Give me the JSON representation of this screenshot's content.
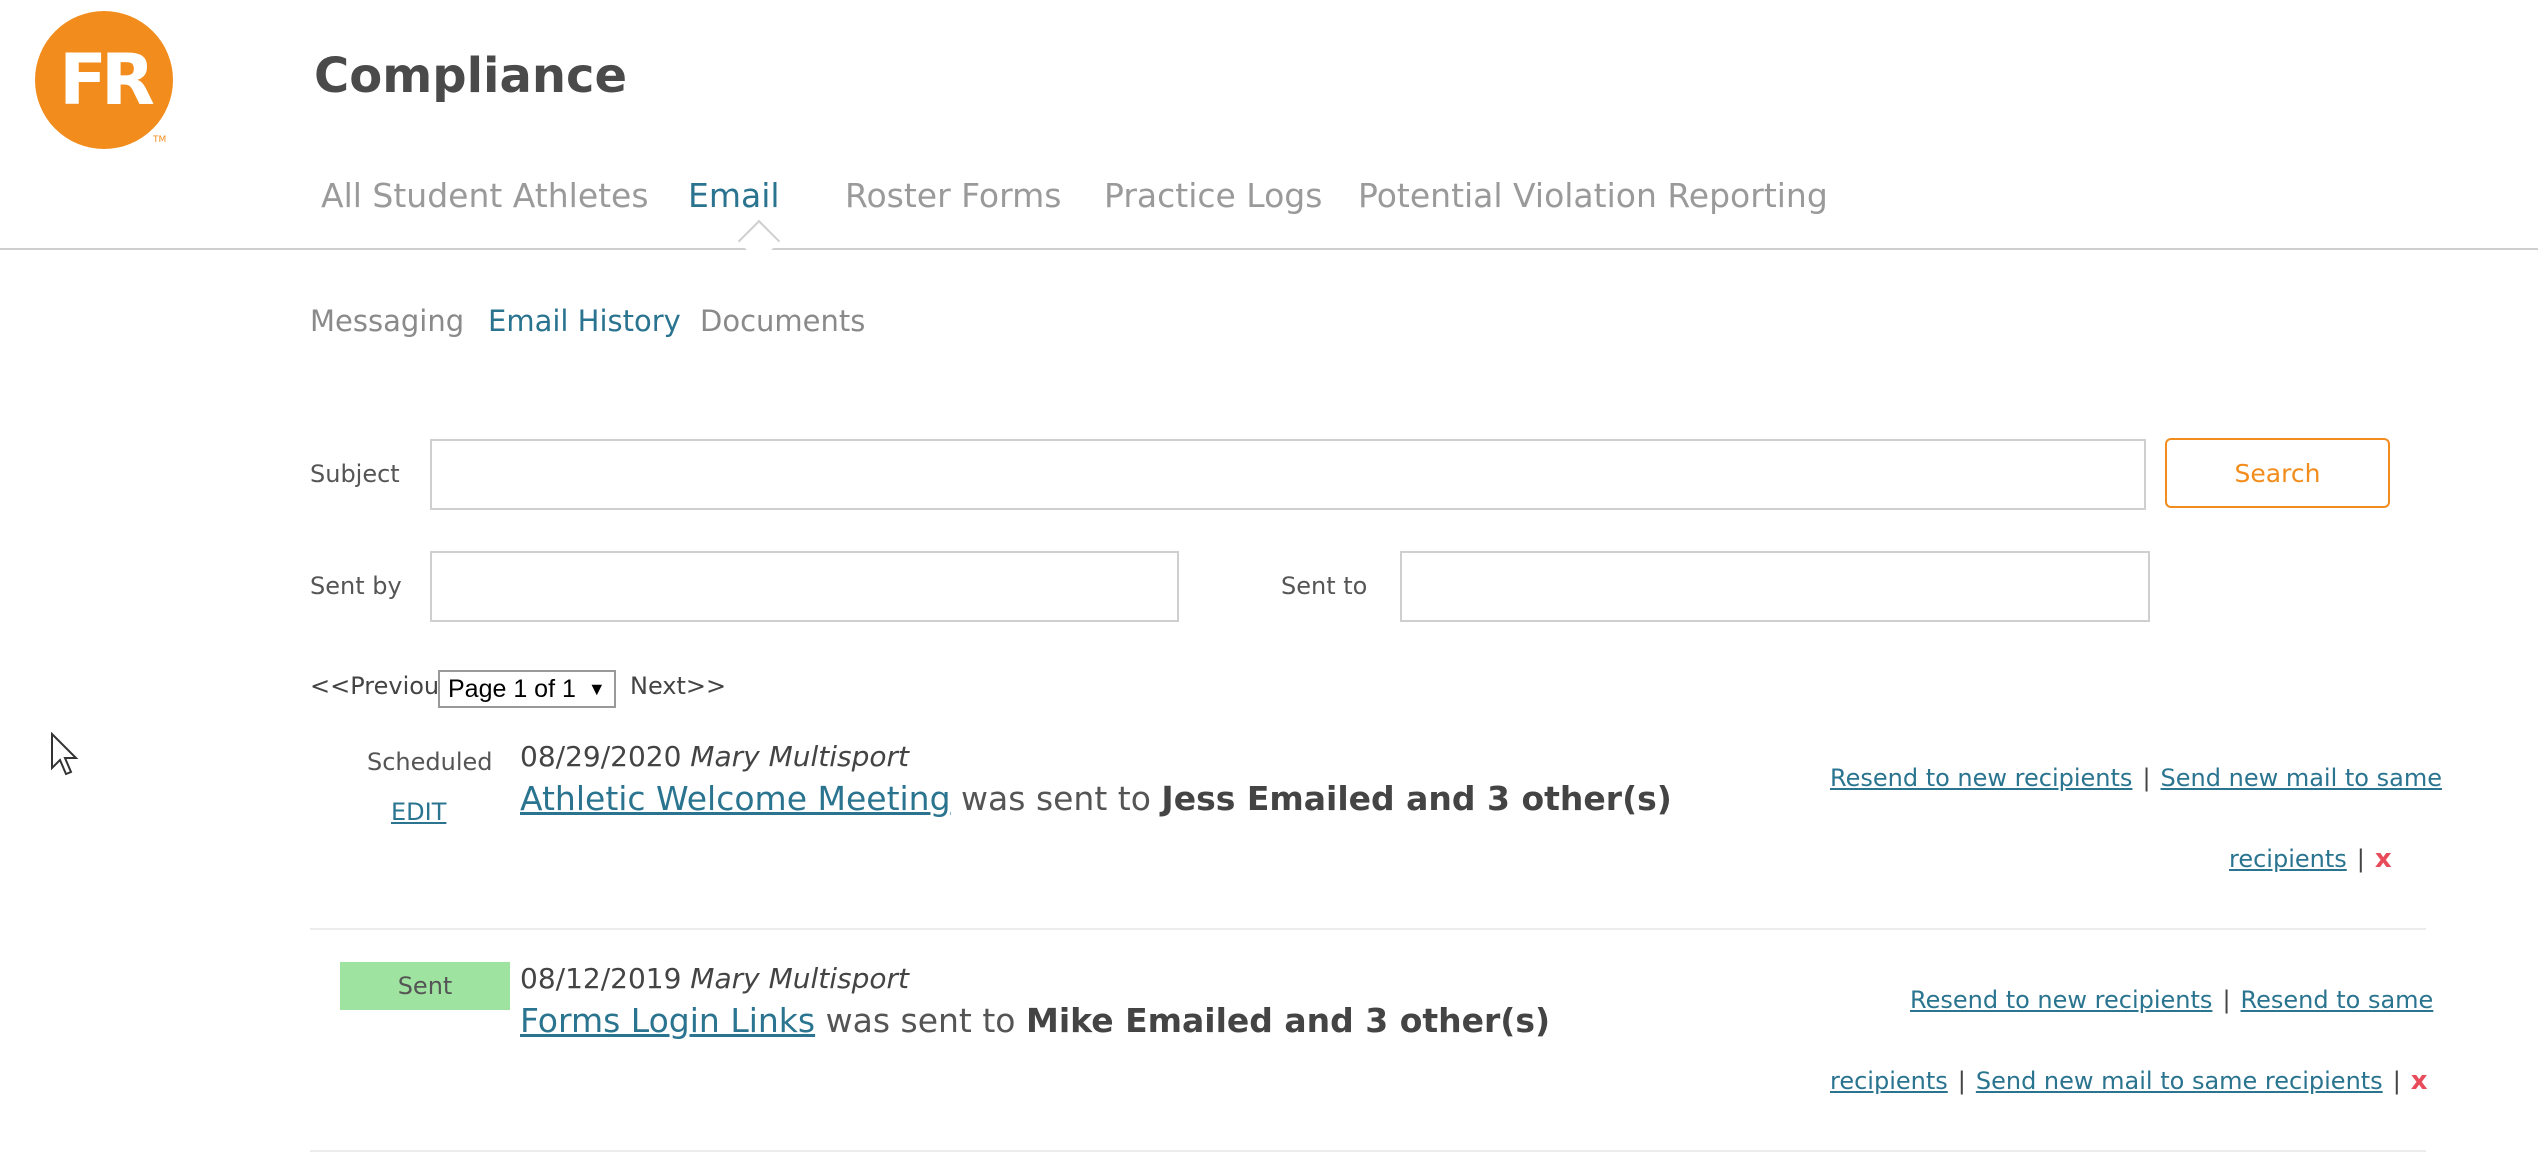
{
  "brand": {
    "logo_text": "FR",
    "trademark": "TM",
    "accent": "#f28c1c",
    "link_color": "#2a7490"
  },
  "page_title": "Compliance",
  "main_tabs": [
    {
      "label": "All Student Athletes"
    },
    {
      "label": "Email",
      "active": true
    },
    {
      "label": "Roster Forms"
    },
    {
      "label": "Practice Logs"
    },
    {
      "label": "Potential Violation Reporting"
    }
  ],
  "sub_tabs": [
    {
      "label": "Messaging"
    },
    {
      "label": "Email History",
      "active": true
    },
    {
      "label": "Documents"
    }
  ],
  "filters": {
    "subject_label": "Subject",
    "subject_value": "",
    "sent_by_label": "Sent by",
    "sent_by_value": "",
    "sent_to_label": "Sent to",
    "sent_to_value": "",
    "search_label": "Search"
  },
  "pager": {
    "prev_label": "<<Previous",
    "page_select": "Page 1 of 1",
    "next_label": "Next>>"
  },
  "emails": [
    {
      "status": "Scheduled",
      "edit_label": "EDIT",
      "date": "08/29/2020",
      "sender": "Mary Multisport",
      "subject": "Athletic Welcome Meeting",
      "connector": "was sent to",
      "recipients": "Jess Emailed and 3 other(s)",
      "action_1": "Resend to new recipients",
      "action_2a": "Send new mail to same",
      "action_2b": "recipients",
      "delete_label": "x"
    },
    {
      "status": "Sent",
      "status_color": "#9fe3a0",
      "date": "08/12/2019",
      "sender": "Mary Multisport",
      "subject": "Forms Login Links",
      "connector": "was sent to",
      "recipients": "Mike Emailed and 3 other(s)",
      "action_1": "Resend to new recipients",
      "action_2a": "Resend to same",
      "action_2b": "recipients",
      "action_3": "Send new mail to same recipients",
      "delete_label": "x"
    }
  ]
}
